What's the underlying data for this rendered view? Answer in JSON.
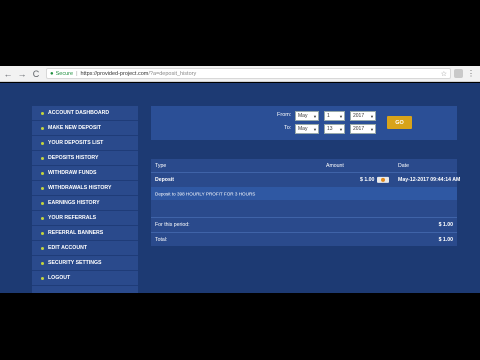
{
  "browser": {
    "back": "←",
    "forward": "→",
    "reload": "C",
    "secure_label": "Secure",
    "url_sep": "|",
    "url_host": "https://provided-project.com",
    "url_path": "/?a=deposit_history"
  },
  "sidebar": {
    "items": [
      {
        "label": "ACCOUNT DASHBOARD"
      },
      {
        "label": "MAKE NEW DEPOSIT"
      },
      {
        "label": "YOUR DEPOSITS LIST"
      },
      {
        "label": "DEPOSITS HISTORY"
      },
      {
        "label": "WITHDRAW FUNDS"
      },
      {
        "label": "WITHDRAWALS HISTORY"
      },
      {
        "label": "EARNINGS HISTORY"
      },
      {
        "label": "YOUR REFERRALS"
      },
      {
        "label": "REFERRAL BANNERS"
      },
      {
        "label": "EDIT ACCOUNT"
      },
      {
        "label": "SECURITY SETTINGS"
      },
      {
        "label": "LOGOUT"
      }
    ]
  },
  "filter": {
    "from_label": "From:",
    "to_label": "To:",
    "from_month": "May",
    "from_day": "1",
    "from_year": "2017",
    "to_month": "May",
    "to_day": "13",
    "to_year": "2017",
    "go_label": "GO"
  },
  "history": {
    "col_type": "Type",
    "col_amount": "Amount",
    "col_date": "Date",
    "row_type": "Deposit",
    "row_amount": "$ 1.00",
    "row_date": "May-12-2017 09:44:14 AM",
    "row_note": "Deposit to 398 HOURLY PROFIT FOR 3 HOURS",
    "period_label": "For this period:",
    "period_value": "$ 1.00",
    "total_label": "Total:",
    "total_value": "$ 1.00"
  },
  "colors": {
    "page_bg": "#1d3a73",
    "panel_bg": "#2a4a8c",
    "go_button": "#d8a31a",
    "bullet": "#c5d63b"
  }
}
